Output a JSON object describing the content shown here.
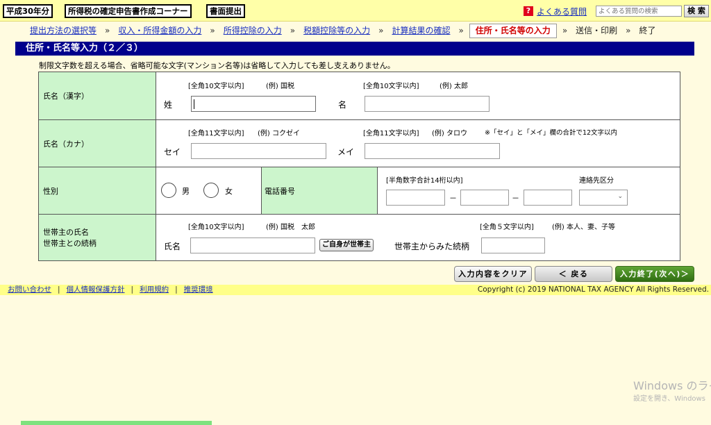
{
  "topbar": {
    "year_tab": "平成30年分",
    "corner_title": "所得税の確定申告書作成コーナー",
    "submit_tab": "書面提出",
    "help_icon": "?",
    "help_link": "よくある質問",
    "search_placeholder": "よくある質問の検索",
    "search_button": "検 索"
  },
  "breadcrumb": {
    "items": [
      "提出方法の選択等",
      "収入・所得金額の入力",
      "所得控除の入力",
      "税額控除等の入力",
      "計算結果の確認"
    ],
    "separator": "»",
    "current": "住所・氏名等の入力",
    "remaining": [
      "送信・印刷",
      "終了"
    ]
  },
  "page_title": "住所・氏名等入力（２／３）",
  "note": "制限文字数を超える場合、省略可能な文字(マンション名等)は省略して入力しても差し支えありません。",
  "form": {
    "kanji": {
      "label": "氏名（漢字）",
      "sei_hint": "[全角10文字以内]",
      "sei_example": "(例) 国税",
      "mei_hint": "[全角10文字以内]",
      "mei_example": "(例) 太郎",
      "sei_label": "姓",
      "mei_label": "名",
      "sei_value": "",
      "mei_value": ""
    },
    "kana": {
      "label": "氏名（カナ）",
      "sei_hint": "[全角11文字以内]",
      "sei_example": "(例) コクゼイ",
      "mei_hint": "[全角11文字以内]",
      "mei_example": "(例) タロウ",
      "total_note": "※「セイ」と「メイ」欄の合計で12文字以内",
      "sei_label": "セイ",
      "mei_label": "メイ",
      "sei_value": "",
      "mei_value": ""
    },
    "gender": {
      "label": "性別",
      "male": "男",
      "female": "女"
    },
    "phone": {
      "label": "電話番号",
      "hint": "[半角数字合計14桁以内]",
      "dash": "－",
      "contact_label": "連絡先区分",
      "contact_value": ""
    },
    "household": {
      "label_line1": "世帯主の氏名",
      "label_line2": "世帯主との続柄",
      "name_hint": "[全角10文字以内]",
      "name_example": "(例) 国税　太郎",
      "name_label": "氏名",
      "self_button": "ご自身が世帯主",
      "relation_hint": "[全角５文字以内]",
      "relation_example": "(例) 本人、妻、子等",
      "relation_label": "世帯主からみた続柄"
    }
  },
  "actions": {
    "clear": "入力内容をクリア",
    "back": "＜ 戻る",
    "next": "入力終了(次へ)＞"
  },
  "footer": {
    "links": [
      "お問い合わせ",
      "個人情報保護方針",
      "利用規約",
      "推奨環境"
    ],
    "separator": "|",
    "copyright": "Copyright (c) 2019 NATIONAL TAX AGENCY All Rights Reserved."
  },
  "watermark": {
    "line1": "Windows のライセ",
    "line2": "設定を開き、Windows"
  }
}
